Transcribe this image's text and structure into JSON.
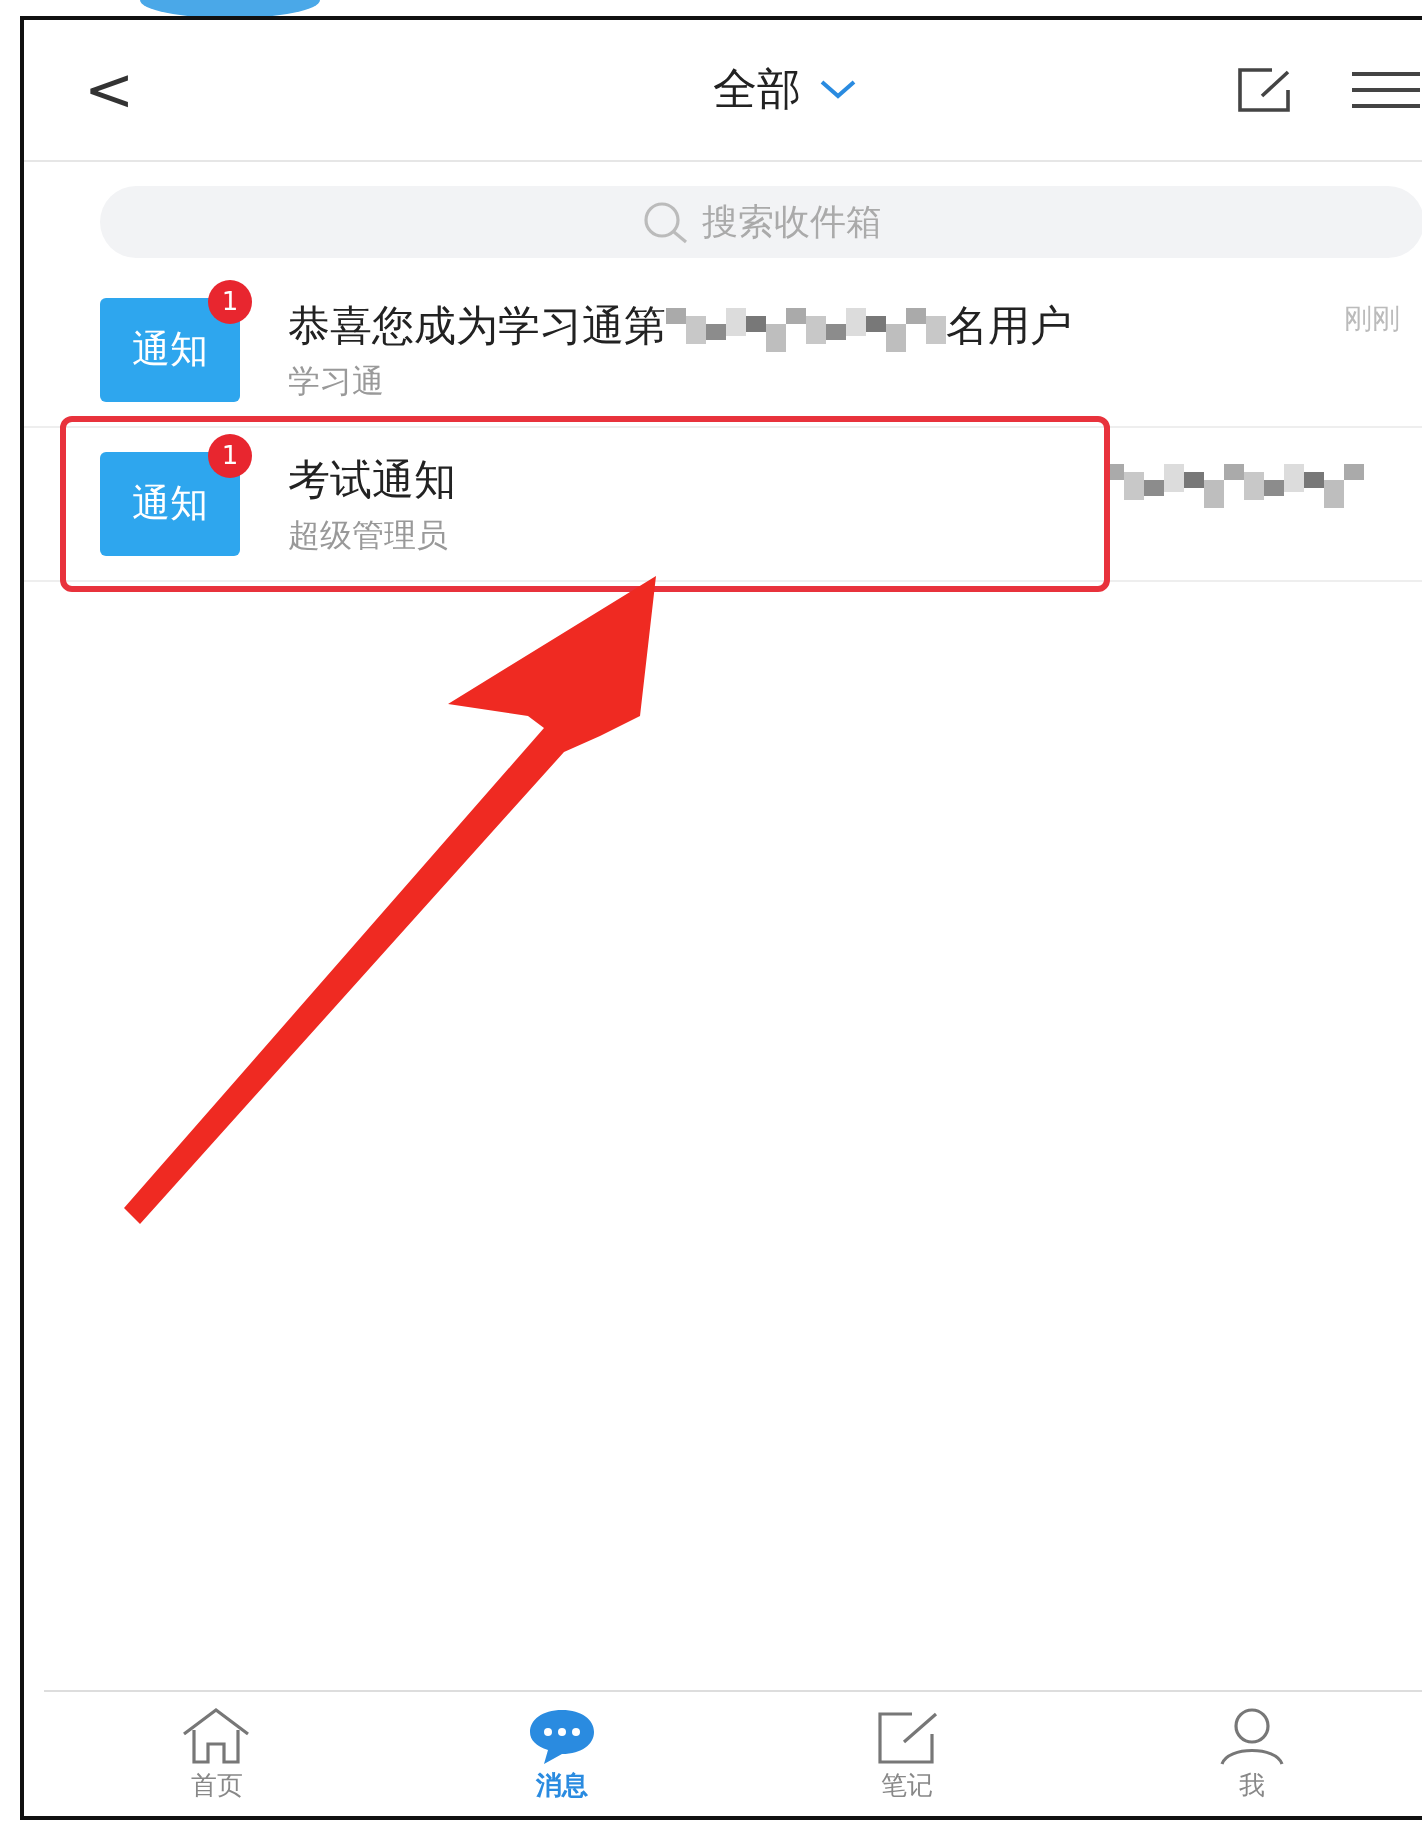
{
  "header": {
    "back": "<",
    "title": "全部"
  },
  "search": {
    "placeholder": "搜索收件箱"
  },
  "messages": [
    {
      "icon_label": "通知",
      "badge": "1",
      "title_parts": [
        "恭喜您成为学习通第",
        "名用户"
      ],
      "sender": "学习通",
      "time": "刚刚",
      "highlighted": false
    },
    {
      "icon_label": "通知",
      "badge": "1",
      "title_parts": [
        "考试通知"
      ],
      "sender": "超级管理员",
      "highlighted": true
    }
  ],
  "tabs": [
    {
      "kind": "home",
      "label": "首页",
      "selected": false
    },
    {
      "kind": "chat",
      "label": "消息",
      "selected": true
    },
    {
      "kind": "note",
      "label": "笔记",
      "selected": false
    },
    {
      "kind": "me",
      "label": "我",
      "selected": false
    }
  ]
}
